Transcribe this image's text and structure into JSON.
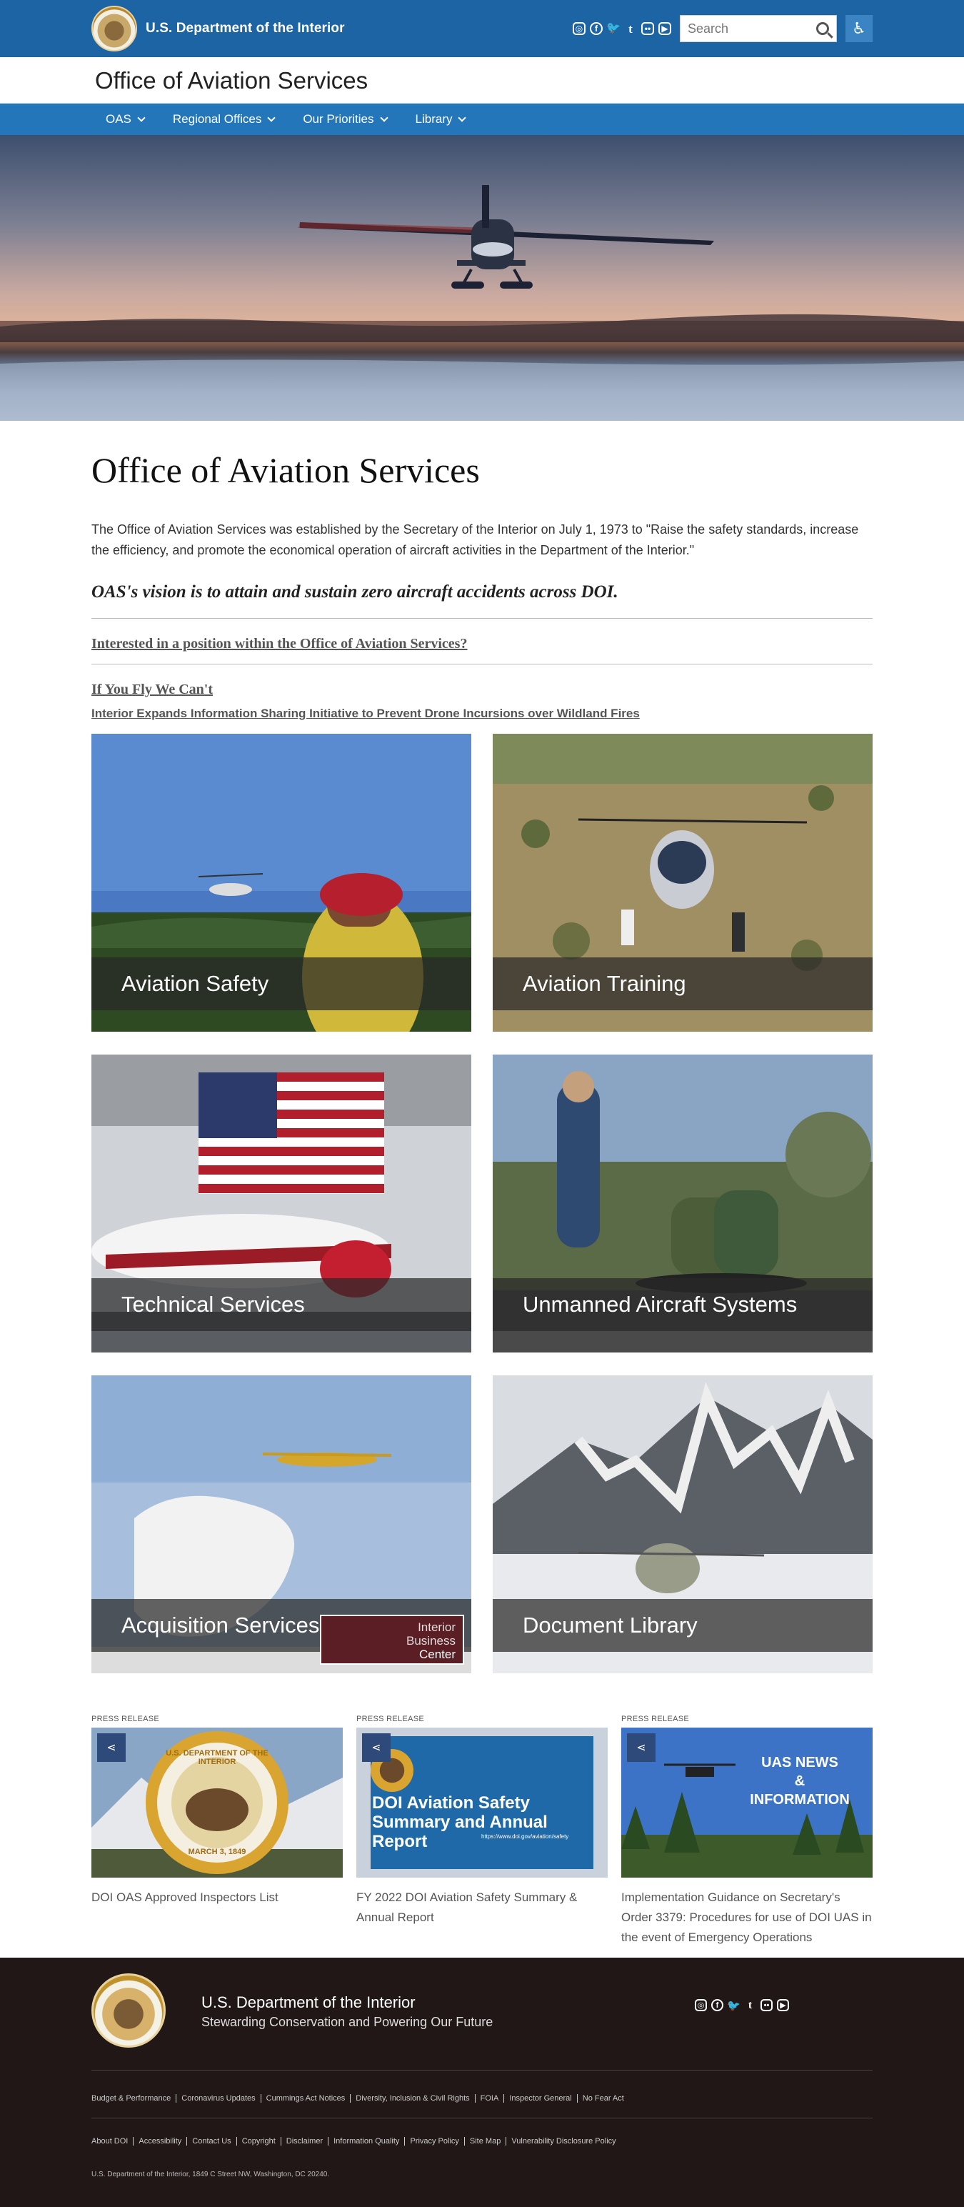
{
  "header": {
    "agency_name": "U.S. Department of the Interior",
    "search_placeholder": "Search",
    "social_icons": [
      "instagram-icon",
      "facebook-icon",
      "twitter-icon",
      "tumblr-icon",
      "flickr-icon",
      "youtube-icon"
    ],
    "accessibility_icon": "accessibility-icon"
  },
  "office": {
    "name": "Office of Aviation Services"
  },
  "nav": {
    "items": [
      {
        "label": "OAS"
      },
      {
        "label": "Regional Offices"
      },
      {
        "label": "Our Priorities"
      },
      {
        "label": "Library"
      }
    ]
  },
  "main": {
    "title": "Office of Aviation Services",
    "intro": "The Office of Aviation Services was established by the Secretary of the Interior on July 1, 1973 to \"Raise the safety standards, increase the efficiency, and promote the economical operation of aircraft activities in the Department of the Interior.\"",
    "vision": "OAS's vision is to attain and sustain zero aircraft accidents across DOI.",
    "position_link": "Interested in a position within the Office of Aviation Services?",
    "fly_link": "If You Fly We Can't",
    "drone_link": "Interior Expands Information Sharing Initiative to Prevent Drone Incursions over Wildland Fires",
    "tiles": [
      {
        "label": "Aviation Safety"
      },
      {
        "label": "Aviation Training"
      },
      {
        "label": "Technical Services"
      },
      {
        "label": "Unmanned Aircraft Systems"
      },
      {
        "label": "Acquisition Services",
        "overlay_text": [
          "Interior",
          "Business",
          "Center"
        ]
      },
      {
        "label": "Document Library"
      }
    ]
  },
  "press": [
    {
      "kicker": "PRESS RELEASE",
      "title": "DOI OAS Approved Inspectors List",
      "image_text": [
        "U.S. DEPARTMENT OF THE INTERIOR",
        "MARCH 3, 1849"
      ]
    },
    {
      "kicker": "PRESS RELEASE",
      "title": "FY 2022 DOI Aviation Safety Summary & Annual Report",
      "image_text": [
        "DOI Aviation Safety",
        "Summary and Annual",
        "Report",
        "https://www.doi.gov/aviation/safety"
      ]
    },
    {
      "kicker": "PRESS RELEASE",
      "title": "Implementation Guidance on Secretary's Order 3379: Procedures for use of DOI UAS in the event of Emergency Operations",
      "image_text": [
        "UAS NEWS",
        "&",
        "INFORMATION"
      ]
    }
  ],
  "footer": {
    "name": "U.S. Department of the Interior",
    "tagline": "Stewarding Conservation and Powering Our Future",
    "links_row1": [
      "Budget & Performance",
      "Coronavirus Updates",
      "Cummings Act Notices",
      "Diversity, Inclusion & Civil Rights",
      "FOIA",
      "Inspector General",
      "No Fear Act"
    ],
    "links_row2": [
      "About DOI",
      "Accessibility",
      "Contact Us",
      "Copyright",
      "Disclaimer",
      "Information Quality",
      "Privacy Policy",
      "Site Map",
      "Vulnerability Disclosure Policy"
    ],
    "address": "U.S. Department of the Interior, 1849 C Street NW, Washington, DC 20240."
  },
  "colors": {
    "topbar": "#1d64a4",
    "nav": "#2376ba",
    "footer": "#211716",
    "share": "#2d4a7a"
  }
}
